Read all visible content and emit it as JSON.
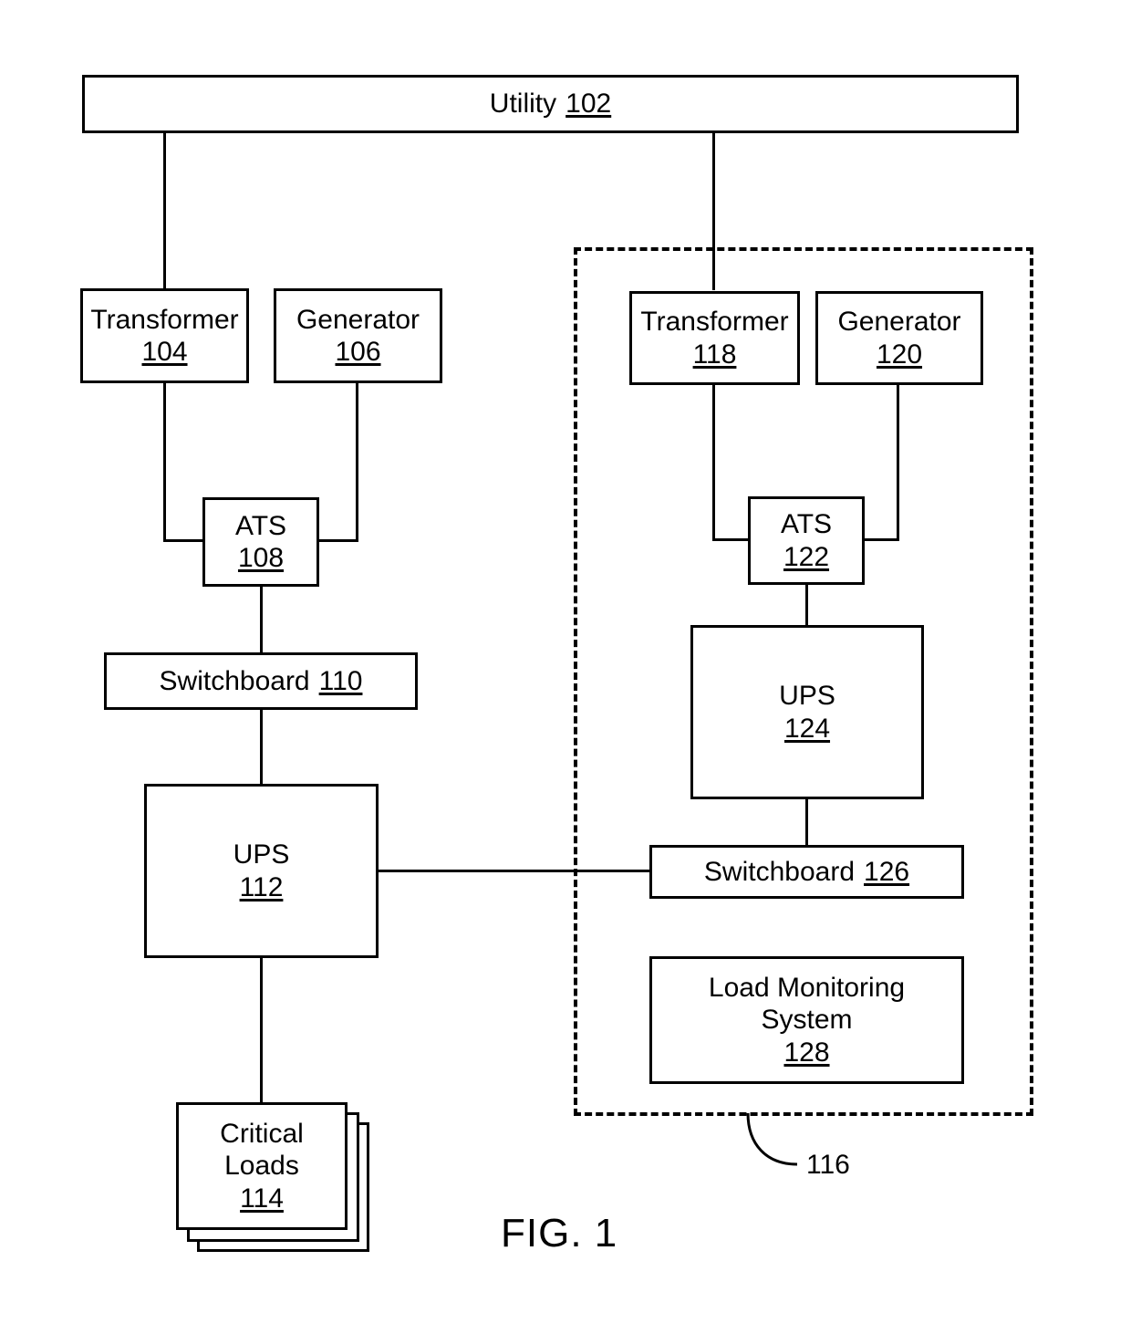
{
  "figure": {
    "caption": "FIG. 1",
    "boundary_ref": "116"
  },
  "nodes": {
    "utility": {
      "label": "Utility",
      "ref": "102"
    },
    "transformer_a": {
      "label": "Transformer",
      "ref": "104"
    },
    "generator_a": {
      "label": "Generator",
      "ref": "106"
    },
    "ats_a": {
      "label": "ATS",
      "ref": "108"
    },
    "switchboard_a": {
      "label": "Switchboard",
      "ref": "110"
    },
    "ups_a": {
      "label": "UPS",
      "ref": "112"
    },
    "critical_loads": {
      "label_line1": "Critical",
      "label_line2": "Loads",
      "ref": "114"
    },
    "transformer_b": {
      "label": "Transformer",
      "ref": "118"
    },
    "generator_b": {
      "label": "Generator",
      "ref": "120"
    },
    "ats_b": {
      "label": "ATS",
      "ref": "122"
    },
    "ups_b": {
      "label": "UPS",
      "ref": "124"
    },
    "switchboard_b": {
      "label": "Switchboard",
      "ref": "126"
    },
    "load_monitoring": {
      "label_line1": "Load Monitoring",
      "label_line2": "System",
      "ref": "128"
    }
  }
}
